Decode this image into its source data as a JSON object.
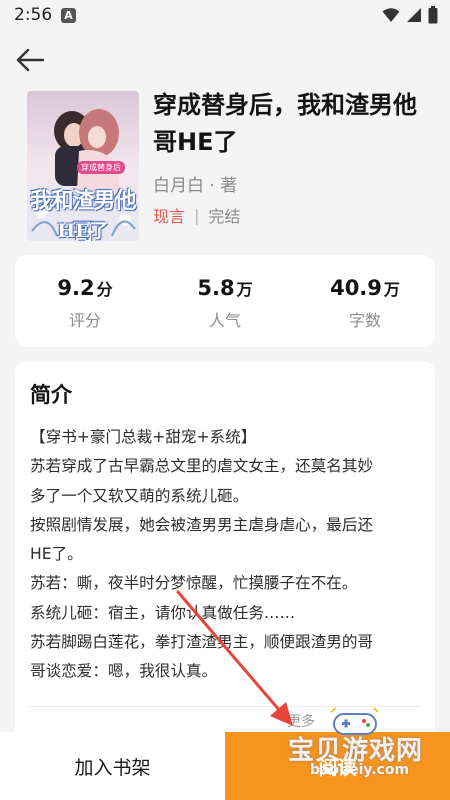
{
  "status_bar": {
    "time": "2:56",
    "notification_badge": "A"
  },
  "book": {
    "title": "穿成替身后，我和渣男他哥HE了",
    "author": "白月白 · 著",
    "genre": "现言",
    "separator": "|",
    "status": "完结",
    "cover_text_main": "我和渣男他哥",
    "cover_text_sub": "HE了",
    "cover_tag": "穿成替身后"
  },
  "stats": [
    {
      "value": "9.2",
      "unit": "分",
      "label": "评分"
    },
    {
      "value": "5.8",
      "unit": "万",
      "label": "人气"
    },
    {
      "value": "40.9",
      "unit": "万",
      "label": "字数"
    }
  ],
  "intro": {
    "heading": "简介",
    "lines": [
      "【穿书+豪门总裁+甜宠+系统】",
      "苏若穿成了古早霸总文里的虐文女主，还莫名其妙",
      "多了一个又软又萌的系统儿砸。",
      "按照剧情发展，她会被渣男男主虐身虐心，最后还",
      "HE了。",
      "苏若：嘶，夜半时分梦惊醒，忙摸腰子在不在。",
      "系统儿砸：宿主，请你认真做任务……",
      "苏若脚踢白莲花，拳打渣渣男主，顺便跟渣男的哥",
      "哥谈恋爱：嗯，我很认真。"
    ],
    "more": "更多"
  },
  "bottom_bar": {
    "add_shelf": "加入书架",
    "read": "阅读"
  },
  "watermark": {
    "title": "宝贝游戏网",
    "url": "baobeiy.com"
  },
  "colors": {
    "accent_orange": "#f7941d",
    "genre_red": "#e45a4f",
    "background": "#f4f4f4",
    "card": "#ffffff"
  }
}
